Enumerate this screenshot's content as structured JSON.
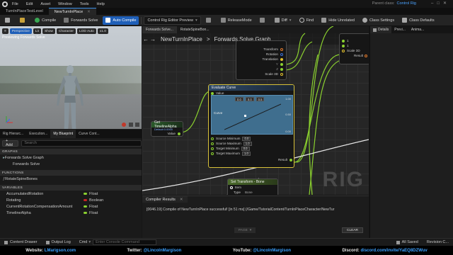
{
  "menubar": {
    "items": [
      "File",
      "Edit",
      "Asset",
      "Window",
      "Tools",
      "Help"
    ],
    "parent_class_label": "Parent class:",
    "parent_class_value": "Control Rig"
  },
  "tabs": [
    {
      "label": "TurnInPlaceTestLevel"
    },
    {
      "label": "NewTurnInPlace"
    }
  ],
  "toolbar": {
    "compile": "Compile",
    "forwards_solve": "Forwards Solve",
    "auto_compile": "Auto Compile",
    "editor_preview": "Control Rig Editor Preview",
    "release_mode": "ReleaseMode",
    "diff": "Diff",
    "find": "Find",
    "hide_unrelated": "Hide Unrelated",
    "class_settings": "Class Settings",
    "class_defaults": "Class Defaults"
  },
  "viewport": {
    "buttons": [
      "Perspective",
      "Lit",
      "Show",
      "Character",
      "LOD Auto",
      "x1.0"
    ],
    "preview_label": "Previewing Forwards Solve"
  },
  "left_tabs": [
    "Rig Hierarc...",
    "Execution...",
    "My Blueprint",
    "Curve Cont..."
  ],
  "myblueprint": {
    "add_label": "+ Add",
    "search_placeholder": "Search",
    "graphs_header": "GRAPHS",
    "graph_items": [
      "Forwards Solve Graph",
      "Forwards Solve"
    ],
    "functions_header": "FUNCTIONS",
    "function_items": [
      "RotateSpineBones"
    ],
    "variables_header": "VARIABLES",
    "variables": [
      {
        "name": "AccumulatedRotation",
        "type": "Float",
        "color": "#8bd12f"
      },
      {
        "name": "Rotating",
        "type": "Boolean",
        "color": "#c72323"
      },
      {
        "name": "CurrentRotationCompensationAmount",
        "type": "Float",
        "color": "#8bd12f"
      },
      {
        "name": "TimelineAlpha",
        "type": "Float",
        "color": "#8bd12f"
      }
    ]
  },
  "graph": {
    "tabs": [
      "Forwards Solve...",
      "RotateSpineBon..."
    ],
    "breadcrumb_root": "NewTurnInPlace",
    "breadcrumb_sep": ">",
    "breadcrumb_leaf": "Forwards Solve Graph",
    "watermark": "RIG",
    "node_transform_pins": [
      "Transform",
      "Rotation",
      "Translation",
      "Scale 3D"
    ],
    "node_transform_scale": "Scale 3D",
    "node_transform_scale_val": "2",
    "node_right_pins": [
      "Scale 3D",
      "Result"
    ],
    "node_right_vals": [
      "1",
      "1",
      "2"
    ],
    "timeline_node_title": "Get TimelineAlpha",
    "timeline_node_sub": "Default 0.0000",
    "timeline_node_value": "Value",
    "curve_node_title": "Evaluate Curve",
    "curve_value_pin": "Value",
    "curve_pin": "Curve",
    "curve_vals": [
      "0.0",
      "0.0",
      "0.5"
    ],
    "curve_axis": [
      "1.00",
      "0.50",
      "0.00"
    ],
    "curve_inputs": [
      {
        "label": "Source Minimum",
        "val": "0.0"
      },
      {
        "label": "Source Maximum",
        "val": "1.0"
      },
      {
        "label": "Target Minimum",
        "val": "0.0"
      },
      {
        "label": "Target Maximum",
        "val": "1.0"
      }
    ],
    "curve_result": "Result",
    "settransform_title": "Set Transform - Bone",
    "settransform_pins": [
      "Item",
      "Type",
      "Bone"
    ]
  },
  "compiler": {
    "tab": "Compiler Results",
    "log": "[0046.19] Compile of NewTurnInPlace successful! [in 51 ms] (/Game/TutorialContent/TurnInPlaceCharacter/NewTur",
    "page": "PAGE",
    "clear": "CLEAR"
  },
  "right_panel": {
    "tabs": [
      "Details",
      "Previ...",
      "Anima..."
    ]
  },
  "bottom": {
    "content_drawer": "Content Drawer",
    "output_log": "Output Log",
    "cmd": "Cmd",
    "cmd_placeholder": "Enter Console Command",
    "all_saved": "All Saved",
    "revision": "Revision C..."
  },
  "footer": {
    "website_label": "Website:",
    "website": "LMarigson.com",
    "twitter_label": "Twitter:",
    "twitter": "@LincolnMargison",
    "youtube_label": "YouTube:",
    "youtube": "@LincolnMargison",
    "discord_label": "Discord:",
    "discord": "discord.com/invite/YaEQ8DZWuv"
  },
  "colors": {
    "accent": "#1f5fb8",
    "exec_wire": "#ffffff",
    "float_wire": "#8bd12f",
    "bool_pin": "#c72323"
  }
}
